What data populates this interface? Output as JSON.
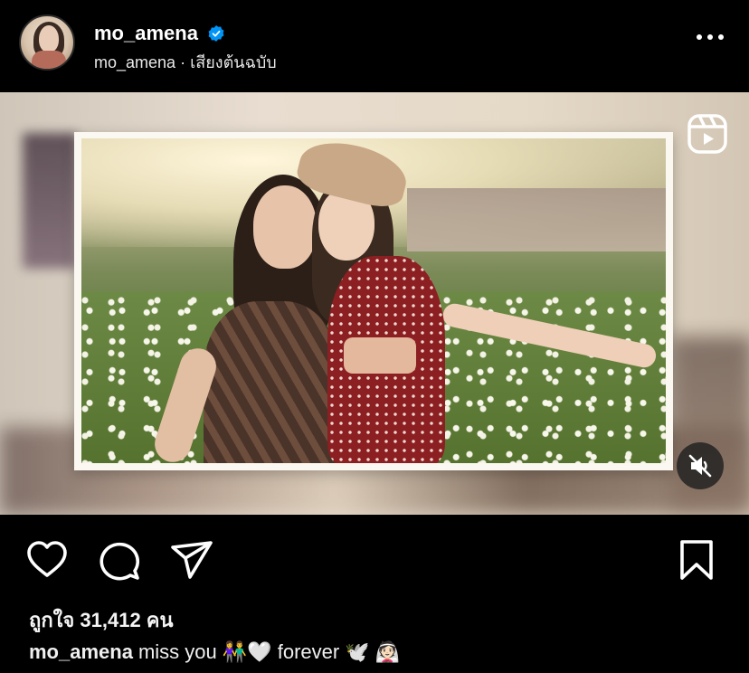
{
  "post": {
    "username": "mo_amena",
    "subtitle_user": "mo_amena",
    "subtitle_separator": "·",
    "subtitle_audio": "เสียงต้นฉบับ",
    "verified": true
  },
  "media": {
    "type": "reel",
    "reels_icon": "reels-icon",
    "mute_icon": "speaker-muted-icon"
  },
  "actions": {
    "like_icon": "heart-icon",
    "comment_icon": "comment-icon",
    "share_icon": "send-icon",
    "save_icon": "bookmark-icon"
  },
  "likes": {
    "label": "ถูกใจ 31,412 คน"
  },
  "caption": {
    "user": "mo_amena",
    "text": "miss you 👫🤍 forever 🕊️ 👰🏻"
  },
  "colors": {
    "background": "#000000",
    "verified_badge": "#0095f6",
    "text": "#f5f5f5"
  }
}
